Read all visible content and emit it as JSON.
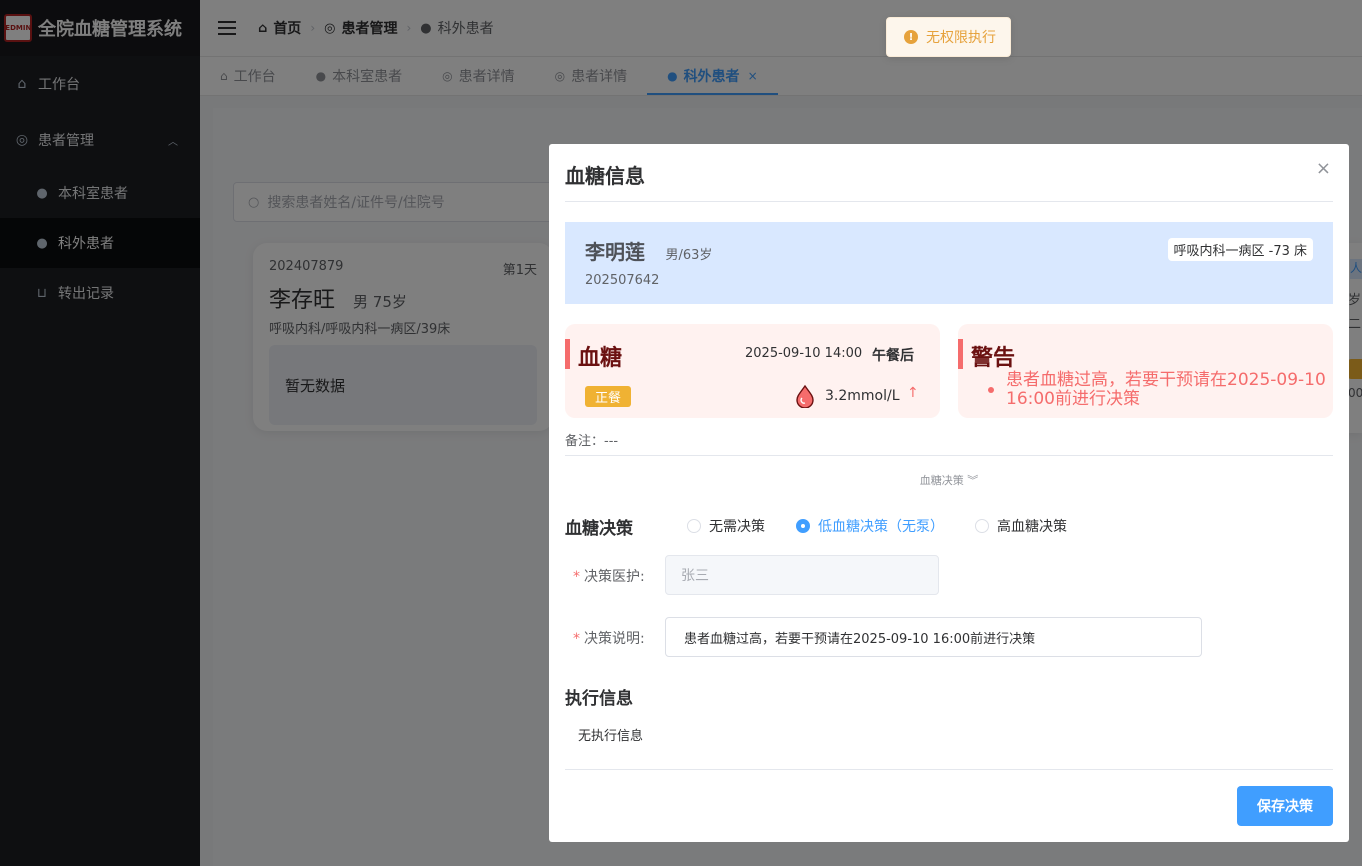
{
  "app": {
    "title": "全院血糖管理系统",
    "logo_text": "REDMINE"
  },
  "sidebar": {
    "items": [
      {
        "label": "工作台",
        "icon": "home-icon"
      },
      {
        "label": "患者管理",
        "icon": "compass-icon",
        "expanded": true
      }
    ],
    "subitems": [
      {
        "label": "本科室患者",
        "icon": "user-icon"
      },
      {
        "label": "科外患者",
        "icon": "user-icon",
        "active": true
      },
      {
        "label": "转出记录",
        "icon": "cart-icon"
      }
    ]
  },
  "breadcrumb": [
    "首页",
    "患者管理",
    "科外患者"
  ],
  "tags": [
    {
      "label": "工作台",
      "icon": "home-icon"
    },
    {
      "label": "本科室患者",
      "icon": "user-icon"
    },
    {
      "label": "患者详情",
      "icon": "compass-icon"
    },
    {
      "label": "患者详情",
      "icon": "compass-icon"
    },
    {
      "label": "科外患者",
      "icon": "user-icon",
      "active": true,
      "close": "×"
    }
  ],
  "search": {
    "placeholder": "搜索患者姓名/证件号/住院号"
  },
  "patient_card": {
    "id": "202407879",
    "day": "第1天",
    "name": "李存旺",
    "gender_age": "男  75岁",
    "dept": "呼吸内科/呼吸内科一病区/39床",
    "nodata": "暂无数据"
  },
  "peek": {
    "p1": "人",
    "p2": "岁",
    "p3": "二",
    "p5": "00"
  },
  "toast": {
    "text": "无权限执行",
    "icon": "warning-icon",
    "color": "#e6a23c"
  },
  "dialog": {
    "title": "血糖信息",
    "close": "×",
    "patient": {
      "name": "李明莲",
      "gender_age": "男/63岁",
      "id": "202507642",
      "bed": "呼吸内科一病区 -73 床"
    },
    "glucose": {
      "title": "血糖",
      "time": "2025-09-10 14:00",
      "meal": "午餐后",
      "tag": "正餐",
      "value": "3.2mmol/L",
      "arrow": "↑"
    },
    "warning": {
      "title": "警告",
      "message": "患者血糖过高，若要干预请在2025-09-10 16:00前进行决策"
    },
    "remark": "备注：---",
    "expand_label": "血糖决策",
    "decision": {
      "title": "血糖决策",
      "options": [
        "无需决策",
        "低血糖决策（无泵）",
        "高血糖决策"
      ],
      "selected": 1
    },
    "form": {
      "doctor_label": "决策医护:",
      "doctor_value": "张三",
      "desc_label": "决策说明:",
      "desc_value": "患者血糖过高，若要干预请在2025-09-10 16:00前进行决策"
    },
    "exec": {
      "title": "执行信息",
      "empty": "无执行信息"
    },
    "save_label": "保存决策"
  },
  "colors": {
    "primary": "#409eff",
    "danger": "#f56c6c",
    "warning": "#e6a23c",
    "sidebar_bg": "#1d1e22"
  }
}
